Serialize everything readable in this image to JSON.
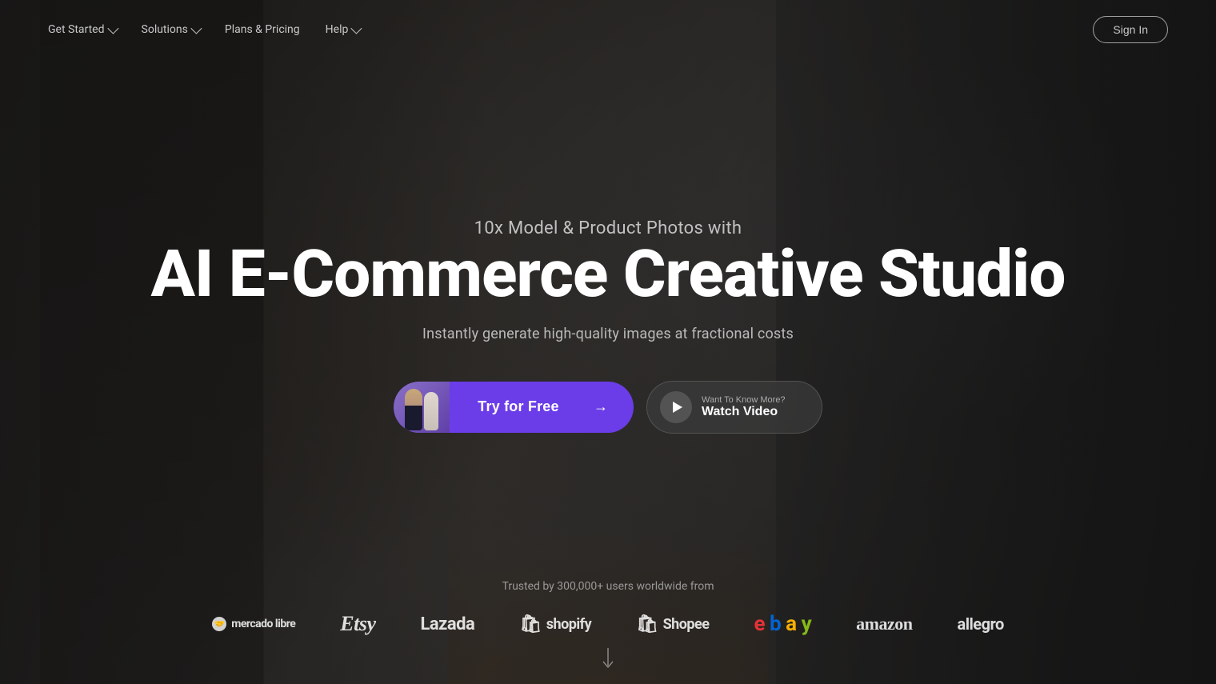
{
  "meta": {
    "title": "AI E-Commerce Creative Studio"
  },
  "nav": {
    "items": [
      {
        "label": "Get Started",
        "has_dropdown": true
      },
      {
        "label": "Solutions",
        "has_dropdown": true
      },
      {
        "label": "Plans & Pricing",
        "has_dropdown": false
      },
      {
        "label": "Help",
        "has_dropdown": true
      }
    ],
    "sign_in_label": "Sign In"
  },
  "hero": {
    "line1": "10x Model & Product Photos with",
    "line2": "AI E-Commerce Creative Studio",
    "description": "Instantly generate high-quality images at fractional costs",
    "cta_primary_label": "Try for Free",
    "cta_primary_arrow": "→",
    "cta_video_small": "Want To Know More?",
    "cta_video_main": "Watch Video"
  },
  "trusted": {
    "text": "Trusted by 300,000+ users worldwide from",
    "brands": [
      {
        "name": "mercado libre",
        "style": "mercadolibre"
      },
      {
        "name": "Etsy",
        "style": "etsy"
      },
      {
        "name": "Lazada",
        "style": "lazada"
      },
      {
        "name": "shopify",
        "style": "shopify"
      },
      {
        "name": "Shopee",
        "style": "shopee"
      },
      {
        "name": "ebay",
        "style": "ebay"
      },
      {
        "name": "amazon",
        "style": "amazon"
      },
      {
        "name": "allegro",
        "style": "allegro"
      }
    ]
  },
  "icons": {
    "chevron_down": "chevron-down-icon",
    "play": "play-icon",
    "arrow_right": "arrow-right-icon",
    "scroll_down": "scroll-down-icon"
  }
}
